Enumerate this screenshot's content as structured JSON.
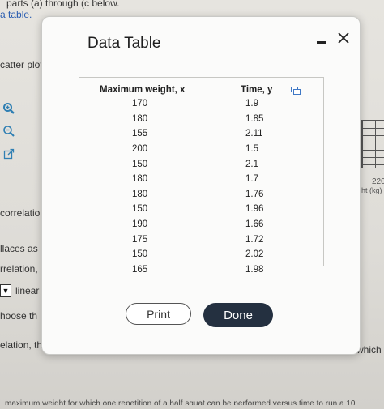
{
  "background": {
    "top_text": "parts (a) through (c below.",
    "link_text": "a table.",
    "left_labels": {
      "scatter": "catter plot",
      "correlation": "correlation",
      "places": "llaces as r",
      "relation": "rrelation,",
      "linear": "linear",
      "choose": "hoose th",
      "lation": "elation, th"
    },
    "right_labels": {
      "axis_tick": "220",
      "axis_unit": "ht (kg)",
      "which": "which"
    },
    "bottom_text": "maximum weight for which one repetition of a half squat can be performed versus time to run a 10"
  },
  "modal": {
    "title": "Data Table",
    "table": {
      "headers": [
        "Maximum weight, x",
        "Time, y"
      ],
      "rows": [
        [
          "170",
          "1.9"
        ],
        [
          "180",
          "1.85"
        ],
        [
          "155",
          "2.11"
        ],
        [
          "200",
          "1.5"
        ],
        [
          "150",
          "2.1"
        ],
        [
          "180",
          "1.7"
        ],
        [
          "180",
          "1.76"
        ],
        [
          "150",
          "1.96"
        ],
        [
          "190",
          "1.66"
        ],
        [
          "175",
          "1.72"
        ],
        [
          "150",
          "2.02"
        ],
        [
          "165",
          "1.98"
        ]
      ]
    },
    "buttons": {
      "print": "Print",
      "done": "Done"
    }
  },
  "colors": {
    "done_button": "#243040",
    "link": "#2a5db0",
    "icon": "#2f7fb3"
  }
}
